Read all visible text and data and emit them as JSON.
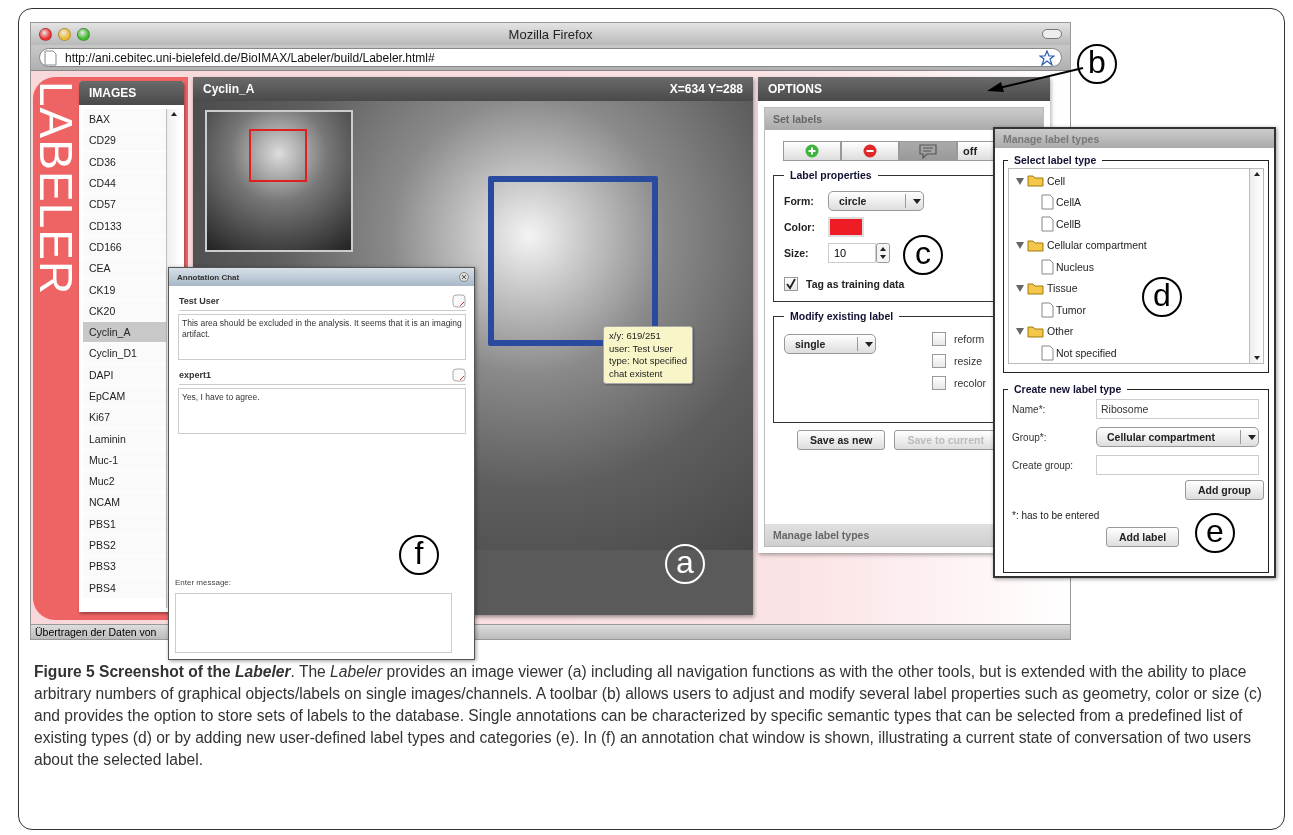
{
  "browser": {
    "title": "Mozilla Firefox",
    "url": "http://ani.cebitec.uni-bielefeld.de/BioIMAX/Labeler/build/Labeler.html#",
    "status": "Übertragen der Daten von"
  },
  "app": {
    "logo": "LABELER",
    "images": {
      "title": "IMAGES",
      "items": [
        {
          "label": "BAX",
          "selected": false
        },
        {
          "label": "CD29",
          "selected": false
        },
        {
          "label": "CD36",
          "selected": false
        },
        {
          "label": "CD44",
          "selected": false
        },
        {
          "label": "CD57",
          "selected": false
        },
        {
          "label": "CD133",
          "selected": false
        },
        {
          "label": "CD166",
          "selected": false
        },
        {
          "label": "CEA",
          "selected": false
        },
        {
          "label": "CK19",
          "selected": false
        },
        {
          "label": "CK20",
          "selected": false
        },
        {
          "label": "Cyclin_A",
          "selected": true
        },
        {
          "label": "Cyclin_D1",
          "selected": false
        },
        {
          "label": "DAPI",
          "selected": false
        },
        {
          "label": "EpCAM",
          "selected": false
        },
        {
          "label": "Ki67",
          "selected": false
        },
        {
          "label": "Laminin",
          "selected": false
        },
        {
          "label": "Muc-1",
          "selected": false
        },
        {
          "label": "Muc2",
          "selected": false
        },
        {
          "label": "NCAM",
          "selected": false
        },
        {
          "label": "PBS1",
          "selected": false
        },
        {
          "label": "PBS2",
          "selected": false
        },
        {
          "label": "PBS3",
          "selected": false
        },
        {
          "label": "PBS4",
          "selected": false
        }
      ]
    },
    "viewer": {
      "title": "Cyclin_A",
      "coords": "X=634 Y=288",
      "tooltip": [
        "x/y: 619/251",
        "user: Test User",
        "type: Not specified",
        "chat existent"
      ]
    },
    "options": {
      "title": "OPTIONS",
      "section": "Set labels",
      "tools": [
        {
          "kind": "add",
          "selected": false
        },
        {
          "kind": "remove",
          "selected": false
        },
        {
          "kind": "chat",
          "selected": true
        },
        {
          "kind": "text",
          "label": "off",
          "selected": false
        }
      ],
      "properties": {
        "legend": "Label properties",
        "form_label": "Form:",
        "form": "circle",
        "color_label": "Color:",
        "color": "#ee1c24",
        "size_label": "Size:",
        "size": "10",
        "training": {
          "label": "Tag as training data",
          "checked": true
        }
      },
      "modify": {
        "legend": "Modify existing label",
        "mode": "single",
        "options": [
          {
            "label": "reform",
            "checked": false
          },
          {
            "label": "resize",
            "checked": false
          },
          {
            "label": "recolor",
            "checked": false
          }
        ]
      },
      "buttons": [
        {
          "label": "Save as new",
          "disabled": false
        },
        {
          "label": "Save to current",
          "disabled": true
        }
      ],
      "footer": "Manage label types"
    }
  },
  "manage": {
    "title": "Manage label types",
    "select_legend": "Select label type",
    "tree": [
      {
        "label": "Cell",
        "expanded": true,
        "children": [
          {
            "label": "CellA"
          },
          {
            "label": "CellB"
          }
        ]
      },
      {
        "label": "Cellular compartment",
        "expanded": true,
        "children": [
          {
            "label": "Nucleus"
          }
        ]
      },
      {
        "label": "Tissue",
        "expanded": true,
        "children": [
          {
            "label": "Tumor"
          }
        ]
      },
      {
        "label": "Other",
        "expanded": true,
        "children": [
          {
            "label": "Not specified"
          }
        ]
      }
    ],
    "create_legend": "Create new label type",
    "name_label": "Name*:",
    "name": "Ribosome",
    "group_label": "Group*:",
    "group": "Cellular compartment",
    "new_group_label": "Create group:",
    "add_group": "Add group",
    "note": "*: has to be entered",
    "add_label": "Add label"
  },
  "chat": {
    "title": "Annotation Chat",
    "messages": [
      {
        "user": "Test User",
        "text": "This area should be excluded in the analysis. It seems that it is an imaging artifact."
      },
      {
        "user": "expert1",
        "text": "Yes, I have to agree."
      }
    ],
    "input_label": "Enter message:"
  },
  "callouts": [
    {
      "letter": "a"
    },
    {
      "letter": "b"
    },
    {
      "letter": "c"
    },
    {
      "letter": "d"
    },
    {
      "letter": "e"
    },
    {
      "letter": "f"
    }
  ],
  "caption": {
    "title": "Figure 5 Screenshot of the *Labeler*",
    "text": ". The *Labeler* provides an image viewer (a) including all navigation functions as with the other tools, but is extended with the ability to place arbitrary numbers of graphical objects/labels on single images/channels. A toolbar (b) allows users to adjust and modify several label properties such as geometry, color or size (c) and provides the option to store sets of labels to the database. Single annotations can be characterized by specific semantic types that can be selected from a predefined list of existing types (d) or by adding new user-defined label types and categories (e). In (f) an annotation chat window is shown, illustrating a current state of conversation of two users about the selected label."
  }
}
